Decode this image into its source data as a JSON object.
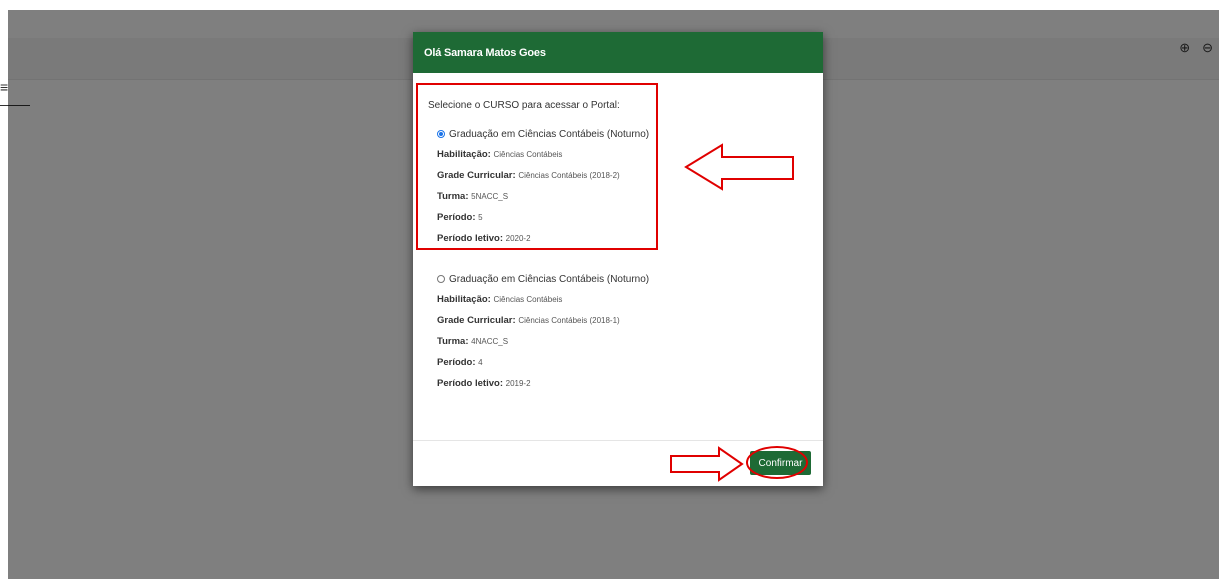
{
  "page": {
    "menu_icon": "hamburger-icon",
    "zoom_in_icon": "zoom-in-icon",
    "zoom_out_icon": "zoom-out-icon"
  },
  "modal": {
    "title": "Olá Samara Matos Goes",
    "prompt": "Selecione o CURSO para acessar o Portal:",
    "courses": [
      {
        "name": "Graduação em Ciências Contábeis (Noturno)",
        "selected": true,
        "habilitacao_label": "Habilitação:",
        "habilitacao": "Ciências Contábeis",
        "grade_label": "Grade Curricular:",
        "grade": "Ciências Contábeis (2018-2)",
        "turma_label": "Turma:",
        "turma": "5NACC_S",
        "periodo_label": "Período:",
        "periodo": "5",
        "periodo_letivo_label": "Período letivo:",
        "periodo_letivo": "2020-2"
      },
      {
        "name": "Graduação em Ciências Contábeis (Noturno)",
        "selected": false,
        "habilitacao_label": "Habilitação:",
        "habilitacao": "Ciências Contábeis",
        "grade_label": "Grade Curricular:",
        "grade": "Ciências Contábeis (2018-1)",
        "turma_label": "Turma:",
        "turma": "4NACC_S",
        "periodo_label": "Período:",
        "periodo": "4",
        "periodo_letivo_label": "Período letivo:",
        "periodo_letivo": "2019-2"
      }
    ],
    "confirm_label": "Confirmar"
  },
  "colors": {
    "header_green": "#1e6a35",
    "annotation_red": "#e00000",
    "radio_blue": "#1a73e8"
  }
}
